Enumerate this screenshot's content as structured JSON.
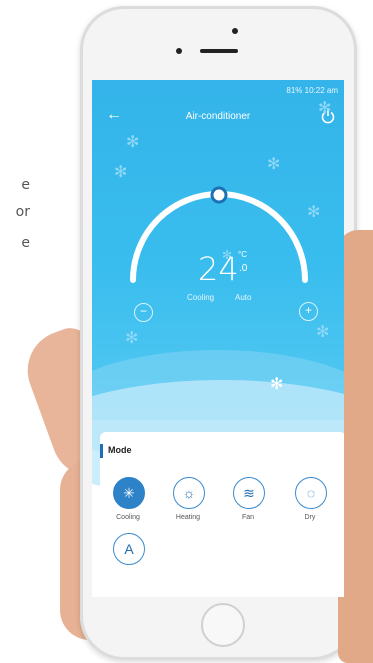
{
  "side_text": {
    "line1": "e",
    "line2": "or",
    "line3": "e"
  },
  "status_bar": {
    "text": "81% 10:22 am"
  },
  "header": {
    "back": "←",
    "title": "Air-conditioner",
    "power_icon": "power-icon"
  },
  "display": {
    "temperature": "24",
    "unit": "°C",
    "decimal": ".0",
    "mode": "Cooling",
    "fan": "Auto",
    "minus": "−",
    "plus": "+"
  },
  "mode_panel": {
    "title": "Mode",
    "modes": [
      {
        "label": "Cooling",
        "glyph": "✳"
      },
      {
        "label": "Heating",
        "glyph": "☼"
      },
      {
        "label": "Fan",
        "glyph": "≋"
      },
      {
        "label": "Dry",
        "glyph": "◌"
      }
    ],
    "auto_glyph": "A"
  },
  "colors": {
    "sky": "#39bdee",
    "accent": "#2d82c8",
    "snow": "#8fd8f7"
  }
}
